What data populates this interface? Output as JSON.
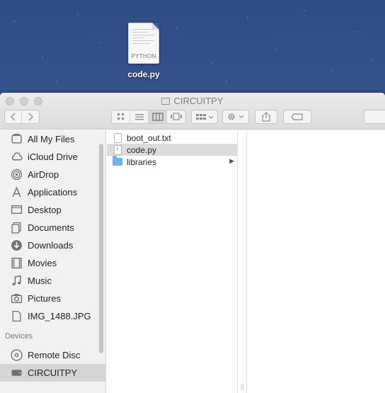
{
  "desktop": {
    "file": {
      "name": "code.py",
      "badge": "PYTHON",
      "icon": "python-document-icon"
    }
  },
  "window": {
    "title": "CIRCUITPY",
    "title_icon": "drive-icon",
    "toolbar": {
      "back_icon": "chevron-left-icon",
      "forward_icon": "chevron-right-icon",
      "view_modes": [
        "icon-view",
        "list-view",
        "column-view",
        "cover-flow-view"
      ],
      "active_view": "column-view",
      "arrange_icon": "arrange-icon",
      "action_icon": "gear-icon",
      "share_icon": "share-icon",
      "tag_icon": "tag-icon"
    }
  },
  "sidebar": {
    "favorites": [
      {
        "label": "All My Files",
        "icon": "all-files-icon"
      },
      {
        "label": "iCloud Drive",
        "icon": "cloud-icon"
      },
      {
        "label": "AirDrop",
        "icon": "airdrop-icon"
      },
      {
        "label": "Applications",
        "icon": "applications-icon"
      },
      {
        "label": "Desktop",
        "icon": "desktop-icon"
      },
      {
        "label": "Documents",
        "icon": "documents-icon"
      },
      {
        "label": "Downloads",
        "icon": "downloads-icon"
      },
      {
        "label": "Movies",
        "icon": "movies-icon"
      },
      {
        "label": "Music",
        "icon": "music-icon"
      },
      {
        "label": "Pictures",
        "icon": "pictures-icon"
      },
      {
        "label": "IMG_1488.JPG",
        "icon": "image-file-icon"
      }
    ],
    "devices_heading": "Devices",
    "devices": [
      {
        "label": "Remote Disc",
        "icon": "disc-icon"
      },
      {
        "label": "CIRCUITPY",
        "icon": "drive-icon",
        "selected": true
      }
    ]
  },
  "column1": {
    "files": [
      {
        "name": "boot_out.txt",
        "icon": "text-file-icon"
      },
      {
        "name": "code.py",
        "icon": "python-file-icon",
        "selected": true
      },
      {
        "name": "libraries",
        "icon": "folder-icon",
        "has_children": true
      }
    ]
  }
}
